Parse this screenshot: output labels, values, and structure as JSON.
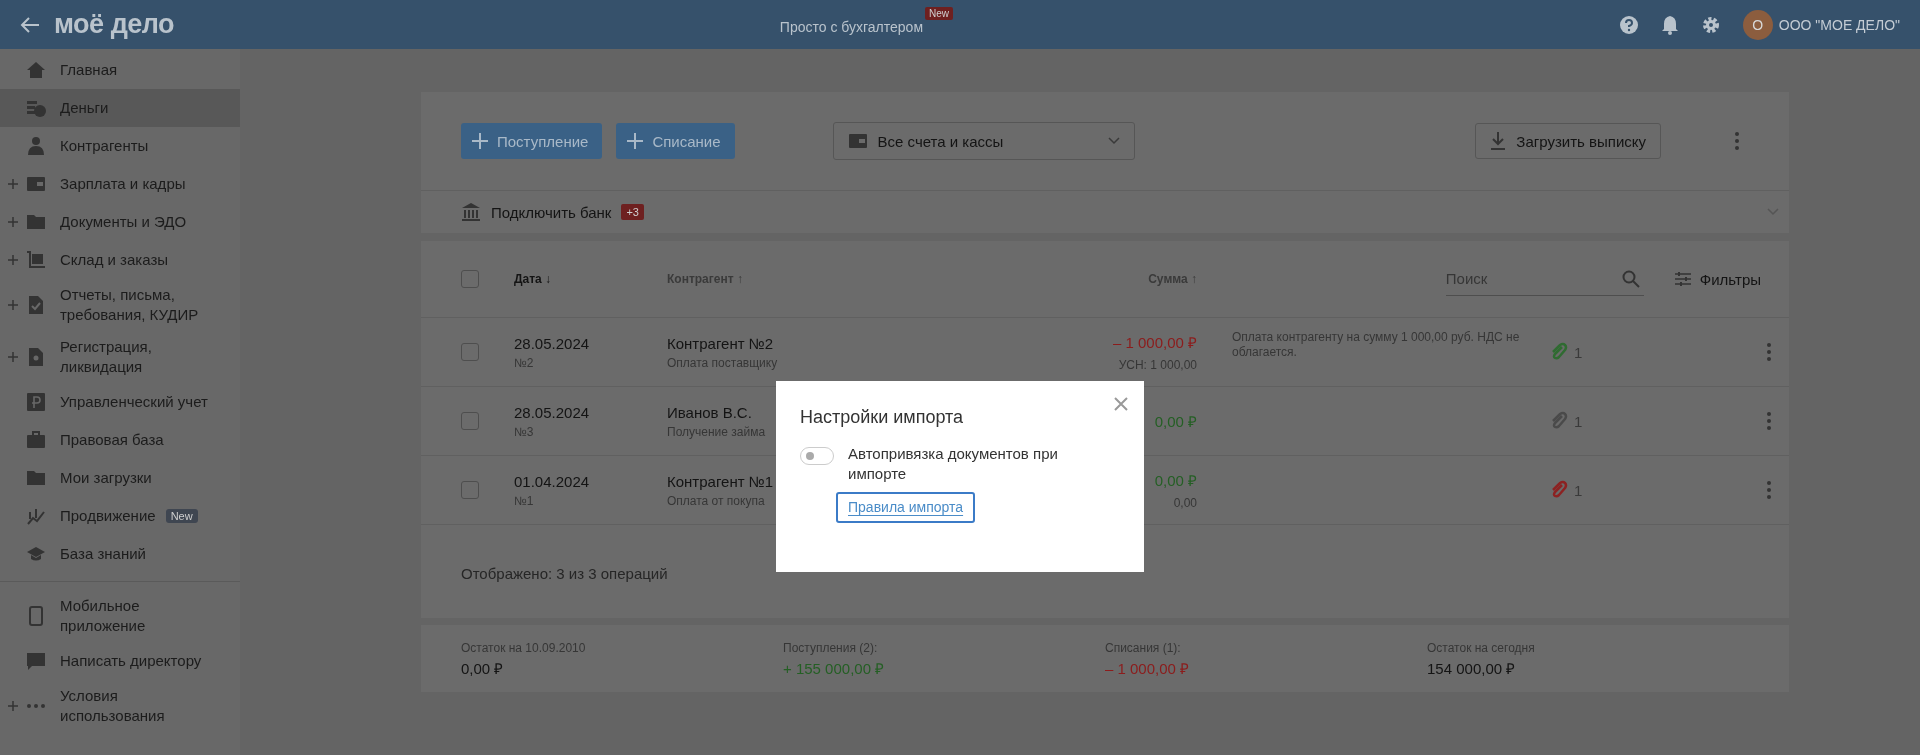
{
  "header": {
    "logo": "моё дело",
    "center_link": "Просто с бухгалтером",
    "center_badge": "New",
    "avatar": "О",
    "company": "ООО \"МОЕ ДЕЛО\""
  },
  "sidebar": {
    "items": [
      {
        "label": "Главная",
        "selected": false,
        "expandable": false
      },
      {
        "label": "Деньги",
        "selected": true,
        "expandable": false
      },
      {
        "label": "Контрагенты",
        "selected": false,
        "expandable": false
      },
      {
        "label": "Зарплата и кадры",
        "selected": false,
        "expandable": true
      },
      {
        "label": "Документы и ЭДО",
        "selected": false,
        "expandable": true
      },
      {
        "label": "Склад и заказы",
        "selected": false,
        "expandable": true
      },
      {
        "label": "Отчеты, письма, требования, КУДИР",
        "selected": false,
        "expandable": true
      },
      {
        "label": "Регистрация, ликвидация",
        "selected": false,
        "expandable": true
      },
      {
        "label": "Управленческий учет",
        "selected": false,
        "expandable": false
      },
      {
        "label": "Правовая база",
        "selected": false,
        "expandable": false
      },
      {
        "label": "Мои загрузки",
        "selected": false,
        "expandable": false
      },
      {
        "label": "Продвижение",
        "badge": "New",
        "selected": false,
        "expandable": false
      },
      {
        "label": "База знаний",
        "selected": false,
        "expandable": false
      }
    ],
    "bottom_items": [
      {
        "label": "Мобильное приложение",
        "selected": false,
        "expandable": false
      },
      {
        "label": "Написать директору",
        "selected": false,
        "expandable": false
      },
      {
        "label": "Условия использования",
        "selected": false,
        "expandable": true
      }
    ]
  },
  "toolbar": {
    "buttons": [
      "Поступление",
      "Списание"
    ],
    "account_select": "Все счета и кассы",
    "upload_button": "Загрузить выписку"
  },
  "bank_row": {
    "label": "Подключить банк",
    "badge": "+3"
  },
  "table": {
    "header_checked": false,
    "columns": [
      "Дата ↓",
      "Контрагент ↑",
      "Сумма ↑"
    ],
    "search": {
      "placeholder": "Поиск"
    },
    "filters": "Фильтры",
    "rows": [
      {
        "checked": false,
        "date": "28.05.2024",
        "number": "№2",
        "counterparty": "Контрагент №2",
        "purpose": "Оплата поставщику",
        "sum": "– 1 000,00 ₽",
        "kind": "expense",
        "tax": "УСН: 1 000,00",
        "comment": "Оплата контрагенту на сумму 1 000,00 руб. НДС не облагается.",
        "attachment": {
          "count": "1",
          "color": "#2f6b31"
        }
      },
      {
        "checked": false,
        "date": "28.05.2024",
        "number": "№3",
        "counterparty": "Иванов В.С.",
        "purpose": "Получение займа",
        "sum": "0,00 ₽",
        "kind": "income",
        "attachment": {
          "count": "1",
          "color": "#4a4a4a"
        }
      },
      {
        "checked": false,
        "date": "01.04.2024",
        "number": "№1",
        "counterparty": "Контрагент №1",
        "purpose": "Оплата от покупа",
        "sum": "0,00 ₽",
        "kind": "income",
        "tax": "0,00",
        "attachment": {
          "count": "1",
          "color": "#8c2222"
        }
      }
    ],
    "summary": "Отображено: 3 из 3 операций"
  },
  "totals": [
    {
      "label": "Остаток на 10.09.2010",
      "value": "0,00 ₽",
      "kind": "neutral"
    },
    {
      "label": "Поступления (2):",
      "value": "+ 155 000,00 ₽",
      "kind": "income"
    },
    {
      "label": "Списания (1):",
      "value": "– 1 000,00 ₽",
      "kind": "expense"
    },
    {
      "label": "Остаток на сегодня",
      "value": "154 000,00 ₽",
      "kind": "neutral"
    }
  ],
  "dialog": {
    "title": "Настройки импорта",
    "toggle": {
      "label": "Автопривязка документов при импорте",
      "on": false
    },
    "link": "Правила импорта"
  }
}
